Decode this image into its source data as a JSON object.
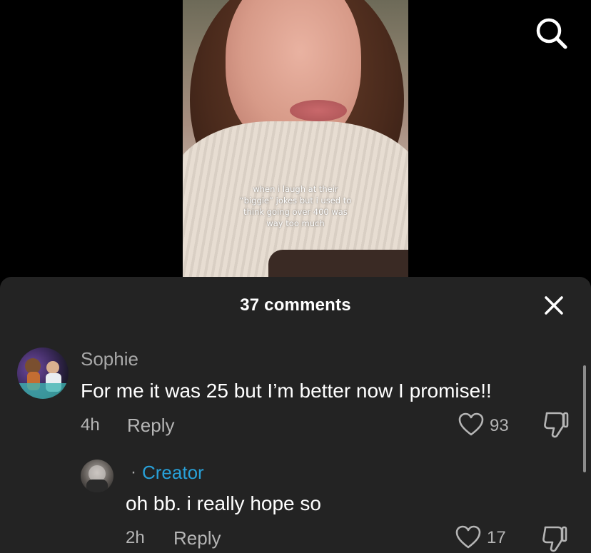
{
  "video": {
    "caption": "when i laugh at their “biggie” jokes but i used to think going over 400 was way too much"
  },
  "icons": {
    "search": "search-icon",
    "close": "close-icon",
    "like": "heart-icon",
    "dislike": "thumbs-down-icon"
  },
  "comments_panel": {
    "title": "37 comments",
    "comments": [
      {
        "username": "Sophie",
        "text": "For me it was 25 but I’m better now I promise!!",
        "time": "4h",
        "reply_label": "Reply",
        "likes": "93"
      }
    ],
    "replies": [
      {
        "separator": "·",
        "badge": "Creator",
        "text": "oh bb. i really hope so",
        "time": "2h",
        "reply_label": "Reply",
        "likes": "17"
      }
    ]
  },
  "colors": {
    "background": "#000000",
    "sheet": "#232323",
    "creator_badge": "#28a0d8",
    "muted_text": "#b5b5b5"
  }
}
